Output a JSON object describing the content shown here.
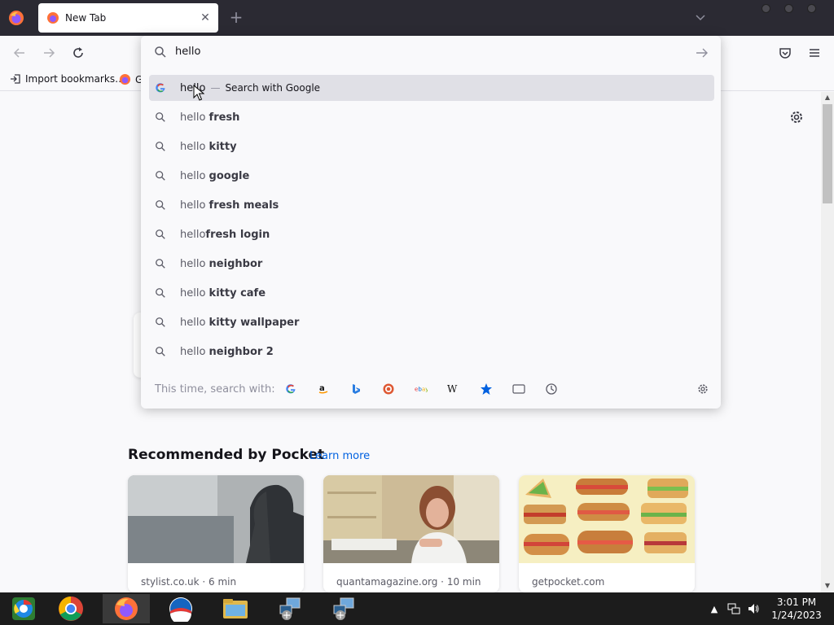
{
  "tab": {
    "title": "New Tab"
  },
  "bookmarks": {
    "import_label": "Import bookmarks…",
    "second_label": "Ge"
  },
  "urlbar": {
    "value": "hello",
    "suggestions": [
      {
        "typed": "hell",
        "rest": "o",
        "action": "Search with Google",
        "active": true
      },
      {
        "typed": "hello ",
        "bold": "fresh"
      },
      {
        "typed": "hello ",
        "bold": "kitty"
      },
      {
        "typed": "hello ",
        "bold": "google"
      },
      {
        "typed": "hello ",
        "bold": "fresh meals"
      },
      {
        "typed": "hello",
        "bold": "fresh login"
      },
      {
        "typed": "hello ",
        "bold": "neighbor"
      },
      {
        "typed": "hello ",
        "bold": "kitty cafe"
      },
      {
        "typed": "hello ",
        "bold": "kitty wallpaper"
      },
      {
        "typed": "hello ",
        "bold": "neighbor 2"
      }
    ],
    "separator": "—",
    "oneoff_label": "This time, search with:",
    "oneoff_engines": [
      "google-icon",
      "amazon-icon",
      "bing-icon",
      "duckduckgo-icon",
      "ebay-icon",
      "wikipedia-icon",
      "bookmarks-icon",
      "tabs-icon",
      "history-icon"
    ]
  },
  "pocket": {
    "heading": "Recommended by Pocket",
    "learn_more": "Learn more",
    "cards": [
      {
        "source": "stylist.co.uk · 6 min"
      },
      {
        "source": "quantamagazine.org · 10 min"
      },
      {
        "source": "getpocket.com"
      }
    ]
  },
  "taskbar": {
    "time": "3:01 PM",
    "date": "1/24/2023"
  },
  "colors": {
    "tabbar": "#2b2a33",
    "accent": "#0061e0",
    "taskbar": "#1c1c1c"
  }
}
